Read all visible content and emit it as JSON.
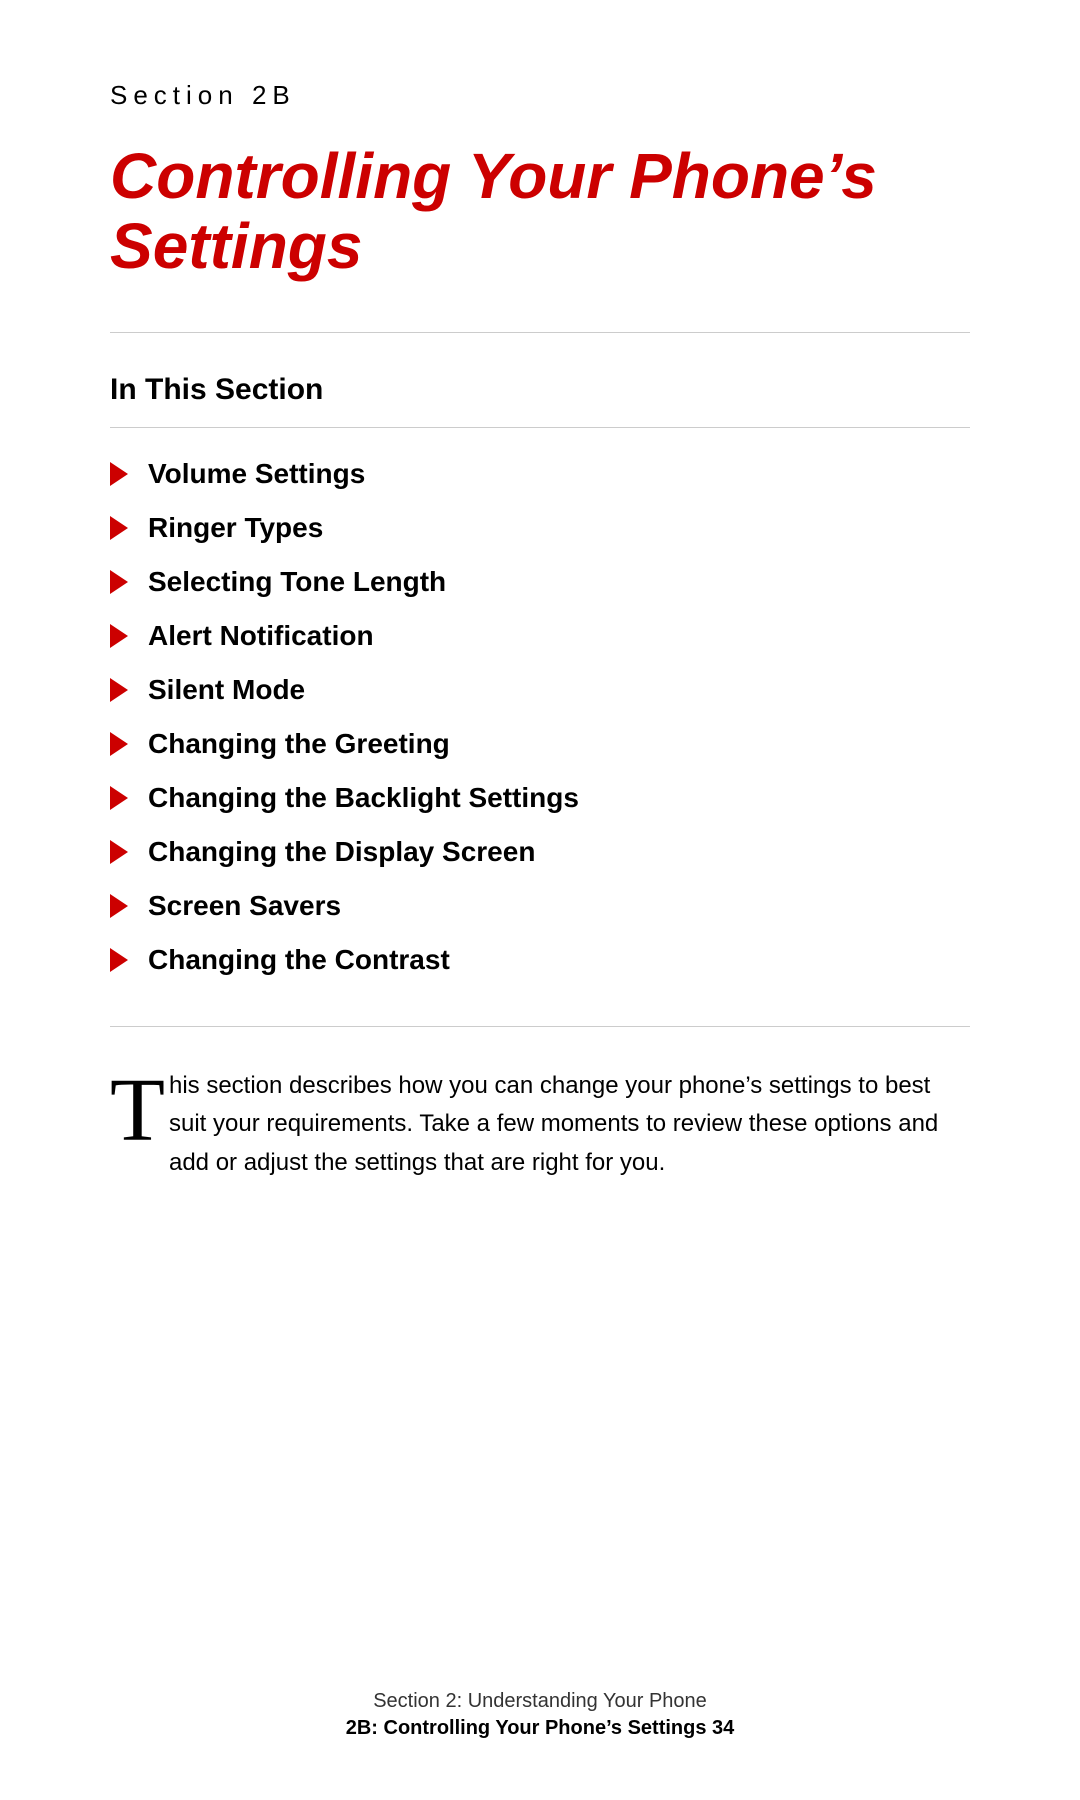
{
  "section": {
    "label": "Section 2B",
    "title": "Controlling Your Phone’s Settings"
  },
  "in_this_section": {
    "heading": "In This Section",
    "items": [
      {
        "label": "Volume Settings"
      },
      {
        "label": "Ringer Types"
      },
      {
        "label": "Selecting Tone Length"
      },
      {
        "label": "Alert Notification"
      },
      {
        "label": "Silent Mode"
      },
      {
        "label": "Changing the Greeting"
      },
      {
        "label": "Changing the Backlight Settings"
      },
      {
        "label": "Changing the Display Screen"
      },
      {
        "label": "Screen Savers"
      },
      {
        "label": "Changing the Contrast"
      }
    ]
  },
  "intro": {
    "drop_cap": "T",
    "text_after_cap": "his section describes how you can change your phone’s settings to best suit your requirements. Take a few moments to review these options and add or adjust the settings that are right for you."
  },
  "footer": {
    "line1": "Section 2: Understanding Your Phone",
    "line2": "2B: Controlling Your Phone’s Settings    34"
  }
}
